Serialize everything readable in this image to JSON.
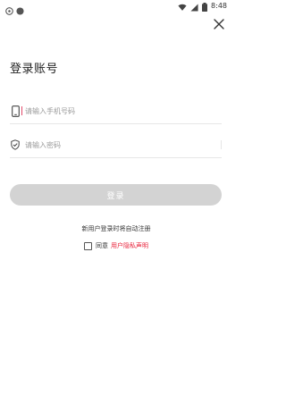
{
  "status_bar": {
    "time": "8:48",
    "icons": [
      "notification-icon",
      "record-icon",
      "wifi-icon",
      "signal-icon",
      "battery-icon"
    ]
  },
  "login": {
    "title": "登录账号",
    "phone_placeholder": "请输入手机号码",
    "password_placeholder": "请输入密码",
    "submit_label": "登录",
    "hint": "新用户登录时将自动注册",
    "agree_label": "同意",
    "privacy_link": "用户隐私声明"
  },
  "colors": {
    "accent_link": "#e8233b",
    "button_disabled": "#d3d3d3",
    "caret": "#e24b6a"
  }
}
